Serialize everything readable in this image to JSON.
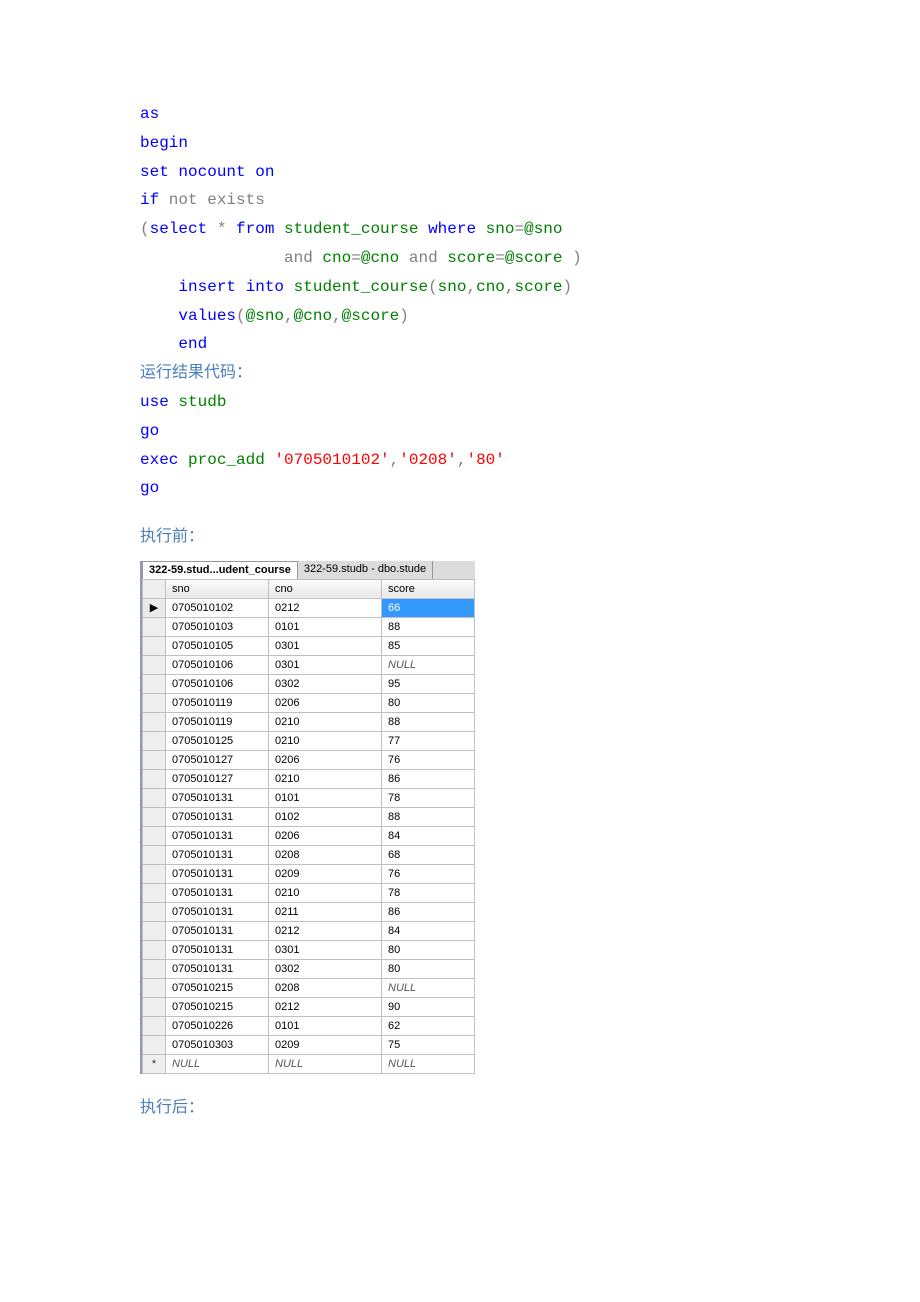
{
  "code1": {
    "line1_as": "as",
    "line2_begin": "begin",
    "line3a": "set",
    "line3b": " nocount ",
    "line3c": "on",
    "line4a": "if",
    "line4b": " not",
    "line4c": " exists",
    "line5a": "(",
    "line5b": "select",
    "line5c": " *",
    "line5d": " from",
    "line5e": " student_course ",
    "line5f": "where",
    "line5g": " sno",
    "line5h": "=",
    "line5i": "@sno",
    "line6a": "               and",
    "line6b": " cno",
    "line6c": "=",
    "line6d": "@cno ",
    "line6e": "and",
    "line6f": " score",
    "line6g": "=",
    "line6h": "@score ",
    "line6i": ")",
    "line7a": "    insert",
    "line7b": " into",
    "line7c": " student_course",
    "line7d": "(",
    "line7e": "sno",
    "line7f": ",",
    "line7g": "cno",
    "line7h": ",",
    "line7i": "score",
    "line7j": ")",
    "line8a": "    values",
    "line8b": "(",
    "line8c": "@sno",
    "line8d": ",",
    "line8e": "@cno",
    "line8f": ",",
    "line8g": "@score",
    "line8h": ")",
    "line9": "    end"
  },
  "label_runresult": "运行结果代码：",
  "code2": {
    "l1a": "use",
    "l1b": " studb",
    "l2": "go",
    "l3a": "exec",
    "l3b": " proc_add ",
    "l3c": "'0705010102'",
    "l3d": ",",
    "l3e": "'0208'",
    "l3f": ",",
    "l3g": "'80'",
    "l4": "go"
  },
  "label_before": "执行前：",
  "label_after": "执行后：",
  "tabs": {
    "active": "322-59.stud...udent_course",
    "other": "322-59.studb - dbo.stude"
  },
  "grid": {
    "headers": {
      "sno": "sno",
      "cno": "cno",
      "score": "score"
    },
    "rows": [
      {
        "sno": "0705010102",
        "cno": "0212",
        "score": "66",
        "sel": true,
        "mark": "▶"
      },
      {
        "sno": "0705010103",
        "cno": "0101",
        "score": "88"
      },
      {
        "sno": "0705010105",
        "cno": "0301",
        "score": "85"
      },
      {
        "sno": "0705010106",
        "cno": "0301",
        "score": "NULL",
        "null": true
      },
      {
        "sno": "0705010106",
        "cno": "0302",
        "score": "95"
      },
      {
        "sno": "0705010119",
        "cno": "0206",
        "score": "80"
      },
      {
        "sno": "0705010119",
        "cno": "0210",
        "score": "88"
      },
      {
        "sno": "0705010125",
        "cno": "0210",
        "score": "77"
      },
      {
        "sno": "0705010127",
        "cno": "0206",
        "score": "76"
      },
      {
        "sno": "0705010127",
        "cno": "0210",
        "score": "86"
      },
      {
        "sno": "0705010131",
        "cno": "0101",
        "score": "78"
      },
      {
        "sno": "0705010131",
        "cno": "0102",
        "score": "88"
      },
      {
        "sno": "0705010131",
        "cno": "0206",
        "score": "84"
      },
      {
        "sno": "0705010131",
        "cno": "0208",
        "score": "68"
      },
      {
        "sno": "0705010131",
        "cno": "0209",
        "score": "76"
      },
      {
        "sno": "0705010131",
        "cno": "0210",
        "score": "78"
      },
      {
        "sno": "0705010131",
        "cno": "0211",
        "score": "86"
      },
      {
        "sno": "0705010131",
        "cno": "0212",
        "score": "84"
      },
      {
        "sno": "0705010131",
        "cno": "0301",
        "score": "80"
      },
      {
        "sno": "0705010131",
        "cno": "0302",
        "score": "80"
      },
      {
        "sno": "0705010215",
        "cno": "0208",
        "score": "NULL",
        "null": true
      },
      {
        "sno": "0705010215",
        "cno": "0212",
        "score": "90"
      },
      {
        "sno": "0705010226",
        "cno": "0101",
        "score": "62"
      },
      {
        "sno": "0705010303",
        "cno": "0209",
        "score": "75"
      },
      {
        "sno": "NULL",
        "cno": "NULL",
        "score": "NULL",
        "allnull": true,
        "mark": "*"
      }
    ]
  }
}
